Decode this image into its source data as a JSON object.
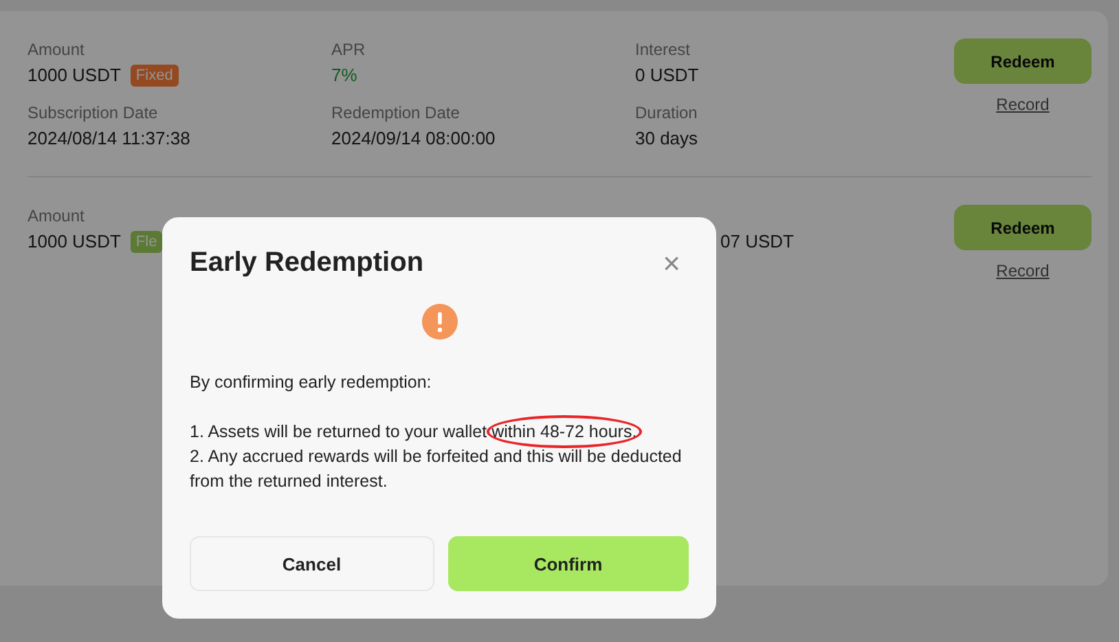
{
  "records": [
    {
      "fields": [
        {
          "label": "Amount",
          "value": "1000 USDT",
          "tag": {
            "label": "Fixed",
            "kind": "fixed"
          }
        },
        {
          "label": "APR",
          "value": "7%",
          "kind": "positive"
        },
        {
          "label": "Interest",
          "value": "0 USDT"
        },
        {
          "label": "Subscription Date",
          "value": "2024/08/14 11:37:38"
        },
        {
          "label": "Redemption Date",
          "value": "2024/09/14 08:00:00"
        },
        {
          "label": "Duration",
          "value": "30 days"
        }
      ],
      "redeem": "Redeem",
      "record": "Record"
    },
    {
      "fields": [
        {
          "label": "Amount",
          "value": "1000 USDT",
          "tag": {
            "label": "Fle",
            "kind": "flexible"
          }
        },
        {
          "value": "07 USDT",
          "kind": "cut"
        }
      ],
      "redeem": "Redeem",
      "record": "Record"
    }
  ],
  "dialog": {
    "title": "Early Redemption",
    "close": "×",
    "intro": "By confirming early redemption:",
    "points": [
      {
        "text": "1. Assets will be returned to your wallet ",
        "highlight": "within 48-72 hours."
      },
      {
        "text": "2. Any accrued rewards will be forfeited and this will be deducted from the returned interest."
      }
    ],
    "cancel": "Cancel",
    "confirm": "Confirm"
  }
}
